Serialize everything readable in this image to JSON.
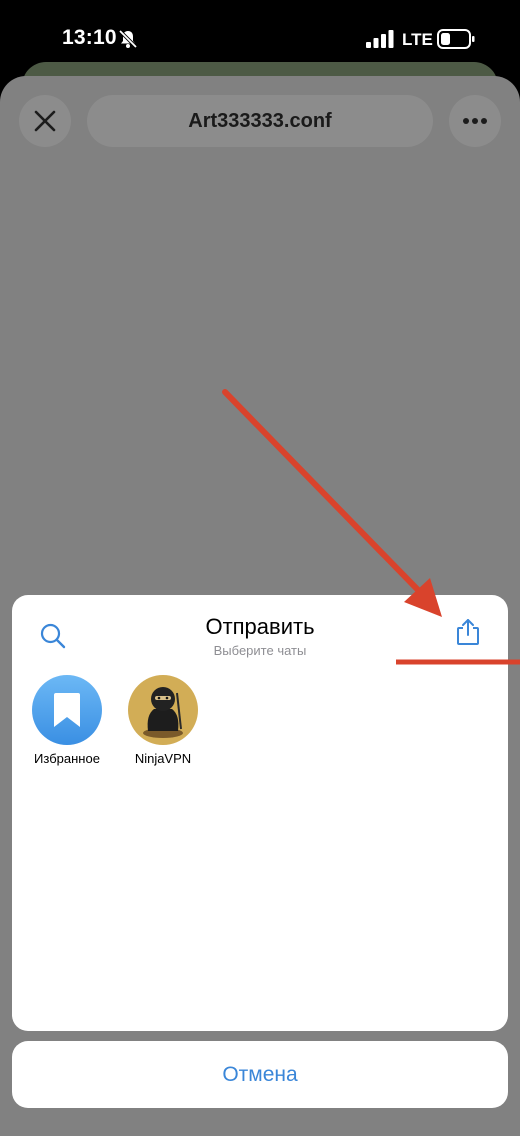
{
  "status_bar": {
    "time": "13:10",
    "network": "LTE"
  },
  "viewer": {
    "file_name": "Art333333.conf"
  },
  "share_sheet": {
    "title": "Отправить",
    "subtitle": "Выберите чаты",
    "chats": [
      {
        "label": "Избранное"
      },
      {
        "label": "NinjaVPN"
      }
    ]
  },
  "cancel_label": "Отмена",
  "colors": {
    "accent": "#3a86d8",
    "annotation": "#d9432c"
  }
}
